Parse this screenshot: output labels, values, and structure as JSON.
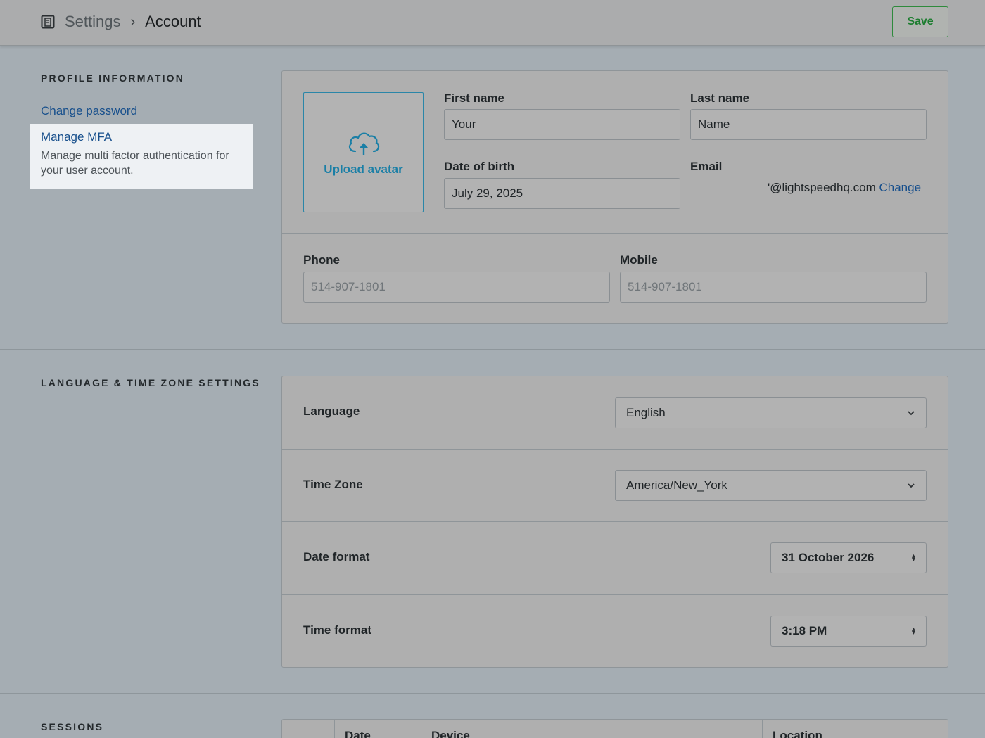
{
  "header": {
    "breadcrumb_root": "Settings",
    "breadcrumb_separator": "›",
    "breadcrumb_current": "Account",
    "save_label": "Save",
    "settings_icon": "settings-building-icon",
    "accent_color": "#1c7d2f"
  },
  "profile": {
    "section_title": "PROFILE INFORMATION",
    "change_password_label": "Change password",
    "manage_mfa_label": "Manage MFA",
    "manage_mfa_desc": "Manage multi factor authentication for your user account.",
    "upload_avatar_label": "Upload avatar",
    "upload_icon": "cloud-upload-icon",
    "first_name_label": "First name",
    "first_name_value": "Your",
    "last_name_label": "Last name",
    "last_name_value": "Name",
    "dob_label": "Date of birth",
    "dob_value": "July 29, 2025",
    "email_label": "Email",
    "email_value": "'@lightspeedhq.com",
    "email_change_label": "Change",
    "phone_label": "Phone",
    "phone_placeholder": "514-907-1801",
    "mobile_label": "Mobile",
    "mobile_placeholder": "514-907-1801"
  },
  "locale": {
    "section_title": "LANGUAGE & TIME ZONE SETTINGS",
    "language_label": "Language",
    "language_value": "English",
    "timezone_label": "Time Zone",
    "timezone_value": "America/New_York",
    "date_format_label": "Date format",
    "date_format_value": "31 October 2026",
    "time_format_label": "Time format",
    "time_format_value": "3:18 PM"
  },
  "sessions": {
    "section_title": "SESSIONS",
    "columns": [
      "Date",
      "Device",
      "Location"
    ]
  }
}
